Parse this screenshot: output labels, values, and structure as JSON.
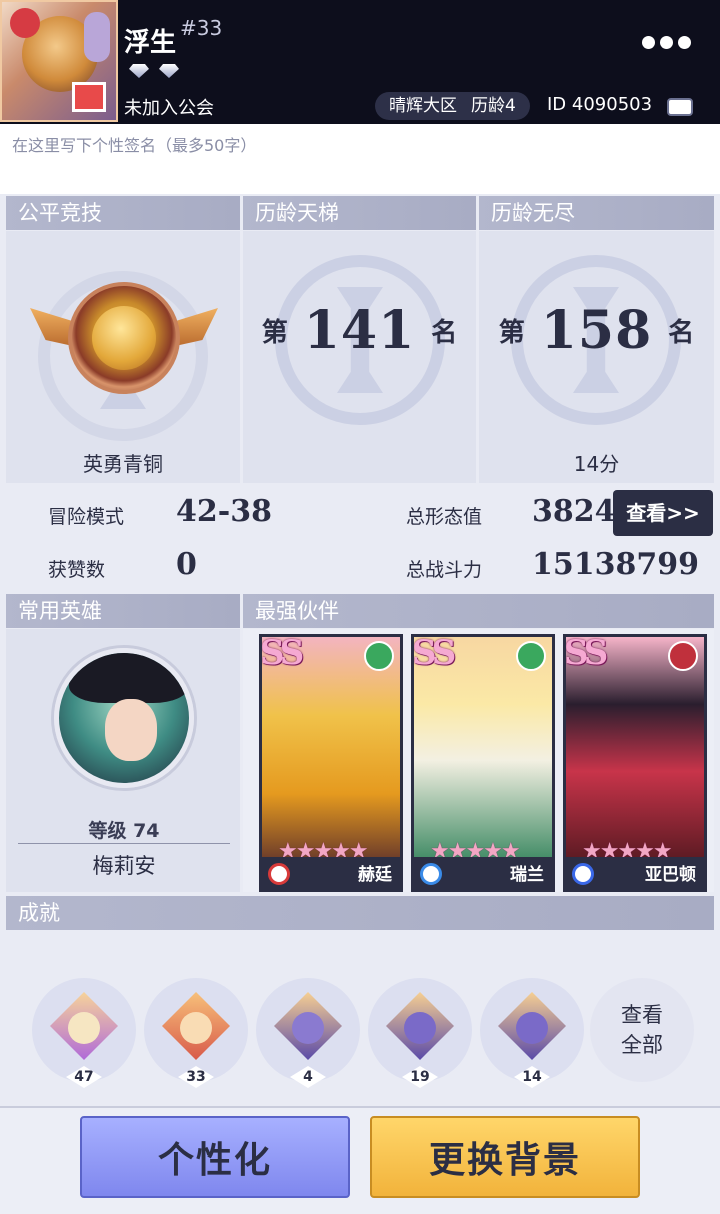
{
  "header": {
    "name": "浮生",
    "rank_tag": "#33",
    "guild": "未加入公会",
    "region": "晴辉大区",
    "seniority": "历龄4",
    "player_id": "ID 4090503"
  },
  "signature": {
    "placeholder": "在这里写下个性签名（最多50字）"
  },
  "panels": {
    "fair": {
      "title": "公平竞技",
      "tier": "英勇青铜"
    },
    "ladder": {
      "title": "历龄天梯",
      "prefix": "第",
      "rank": "141",
      "suffix": "名"
    },
    "endless": {
      "title": "历龄无尽",
      "prefix": "第",
      "rank": "158",
      "suffix": "名",
      "score": "14分"
    }
  },
  "stats": {
    "adventure_label": "冒险模式",
    "adventure_value": "42-38",
    "likes_label": "获赞数",
    "likes_value": "0",
    "form_label": "总形态值",
    "form_value": "3824",
    "view_button": "查看>>",
    "power_label": "总战斗力",
    "power_value": "15138799"
  },
  "hero": {
    "title": "常用英雄",
    "level": "等级 74",
    "name": "梅莉安"
  },
  "partners": {
    "title": "最强伙伴",
    "cards": [
      {
        "grade": "SS",
        "name": "赫廷",
        "stars": "★★★★★"
      },
      {
        "grade": "SS",
        "name": "瑞兰",
        "stars": "★★★★★"
      },
      {
        "grade": "SS",
        "name": "亚巴顿",
        "stars": "★★★★★"
      }
    ]
  },
  "achievements": {
    "title": "成就",
    "badges": [
      {
        "count": "47"
      },
      {
        "count": "33"
      },
      {
        "count": "4"
      },
      {
        "count": "19"
      },
      {
        "count": "14"
      }
    ],
    "view_all_line1": "查看",
    "view_all_line2": "全部"
  },
  "buttons": {
    "personalize": "个性化",
    "change_background": "更换背景"
  },
  "colors": {
    "accent_dark": "#2b2e44",
    "section_header": "#b3b7cd",
    "personalize": "#8f98f5",
    "background_btn": "#f5c24a"
  }
}
